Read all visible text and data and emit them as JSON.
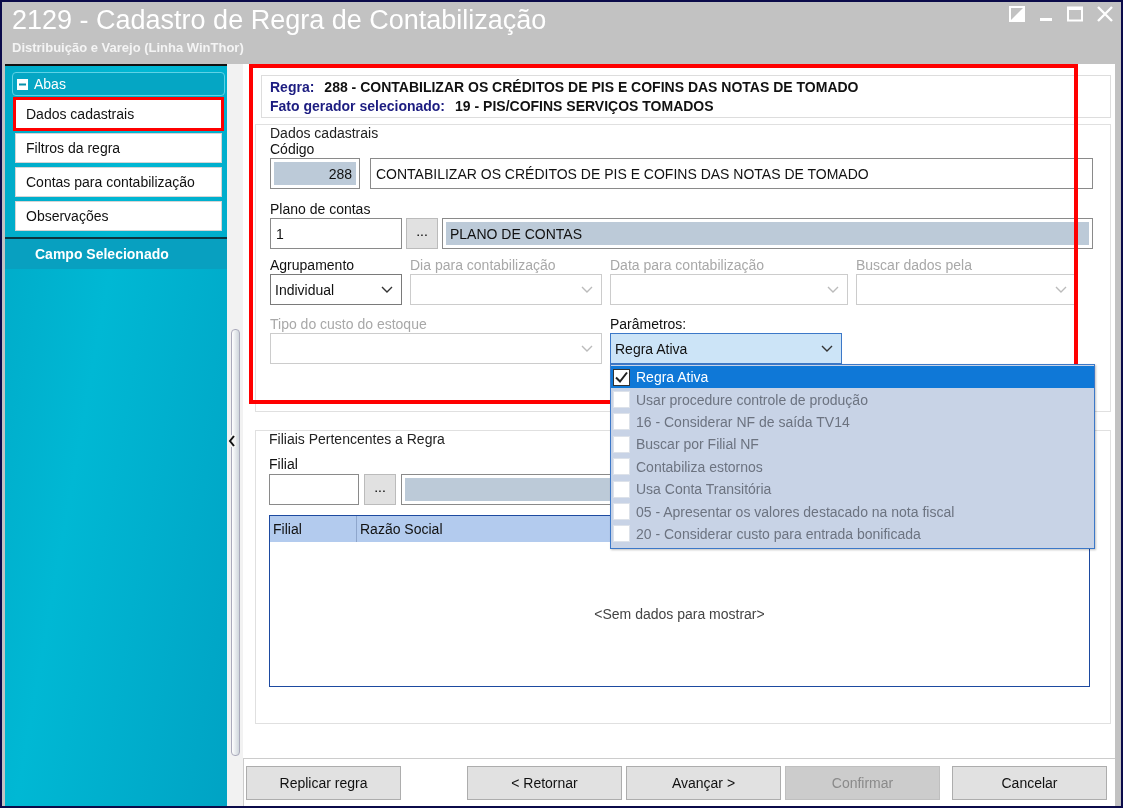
{
  "window": {
    "title": "2129 - Cadastro de Regra de Contabilização",
    "subtitle": "Distribuição e Varejo (Linha WinThor)"
  },
  "sidebar": {
    "header": "Abas",
    "expanded": true,
    "items": [
      {
        "label": "Dados cadastrais",
        "highlighted": true
      },
      {
        "label": "Filtros da regra",
        "highlighted": false
      },
      {
        "label": "Contas para contabilização",
        "highlighted": false
      },
      {
        "label": "Observações",
        "highlighted": false
      }
    ],
    "section": "Campo Selecionado"
  },
  "summary": {
    "highlighted": true,
    "rule_label": "Regra:",
    "rule_value": "288 - CONTABILIZAR OS CRÉDITOS DE PIS E COFINS DAS NOTAS DE TOMADO",
    "trigger_label": "Fato gerador selecionado:",
    "trigger_value": "19 - PIS/COFINS SERVIÇOS TOMADOS"
  },
  "registration": {
    "title": "Dados cadastrais",
    "code_label": "Código",
    "code": "288",
    "description": "CONTABILIZAR OS CRÉDITOS DE PIS E COFINS DAS NOTAS DE TOMADO",
    "chart_label": "Plano de contas",
    "chart_code": "1",
    "lookup_button": "...",
    "chart_name": "PLANO DE CONTAS",
    "selects": [
      {
        "label": "Agrupamento",
        "value": "Individual",
        "disabled": false
      },
      {
        "label": "Dia para contabilização",
        "disabled": true
      },
      {
        "label": "Data para contabilização",
        "disabled": true
      },
      {
        "label": "Buscar dados pela",
        "disabled": true
      },
      {
        "label": "Tipo do custo do estoque",
        "disabled": true
      }
    ],
    "parameters": {
      "label": "Parâmetros:",
      "value": "Regra Ativa",
      "expanded": true,
      "options": [
        {
          "label": "Regra Ativa",
          "checked": true,
          "disabled": false,
          "selected": true
        },
        {
          "label": "Usar procedure controle de produção",
          "checked": false,
          "disabled": true,
          "selected": false
        },
        {
          "label": "16 - Considerar NF de saída TV14",
          "checked": false,
          "disabled": true,
          "selected": false
        },
        {
          "label": "Buscar por Filial NF",
          "checked": false,
          "disabled": true,
          "selected": false
        },
        {
          "label": "Contabiliza estornos",
          "checked": false,
          "disabled": true,
          "selected": false
        },
        {
          "label": "Usa Conta Transitória",
          "checked": false,
          "disabled": true,
          "selected": false
        },
        {
          "label": "05 - Apresentar os valores destacado na nota fiscal",
          "checked": false,
          "disabled": true,
          "selected": false
        },
        {
          "label": "20 - Considerar custo para entrada bonificada",
          "checked": false,
          "disabled": true,
          "selected": false
        }
      ]
    }
  },
  "branches": {
    "title": "Filiais Pertencentes a Regra",
    "field_label": "Filial",
    "lookup_button": "...",
    "columns": [
      "Filial",
      "Razão Social"
    ],
    "empty_text": "<Sem dados para mostrar>"
  },
  "buttons": [
    {
      "label": "Replicar regra",
      "disabled": false
    },
    {
      "label": "< Retornar",
      "disabled": false
    },
    {
      "label": "Avançar >",
      "disabled": false
    },
    {
      "label": "Confirmar",
      "disabled": true
    },
    {
      "label": "Cancelar",
      "disabled": false
    }
  ]
}
